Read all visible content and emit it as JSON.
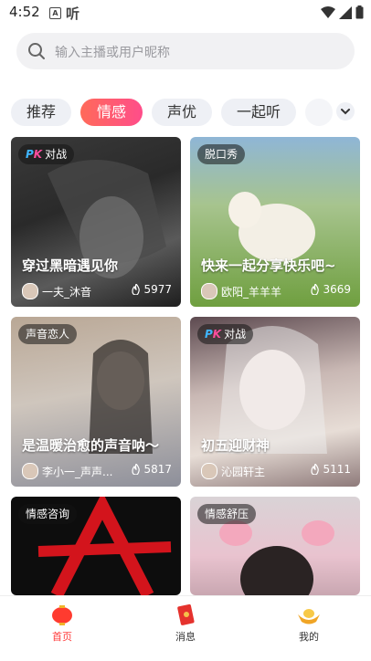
{
  "status_bar": {
    "time": "4:52",
    "notif_a": "A",
    "notif_b": "听"
  },
  "search": {
    "placeholder": "输入主播或用户昵称"
  },
  "tabs": [
    {
      "label": "推荐",
      "active": false
    },
    {
      "label": "情感",
      "active": true
    },
    {
      "label": "声优",
      "active": false
    },
    {
      "label": "一起听",
      "active": false
    }
  ],
  "cards": [
    {
      "tag": "对战",
      "pk": true,
      "title": "穿过黑暗遇见你",
      "user": "一夫_沐音",
      "heat": "5977"
    },
    {
      "tag": "脱口秀",
      "pk": false,
      "title": "快来一起分享快乐吧~",
      "user": "欧阳_羊羊羊",
      "heat": "3669"
    },
    {
      "tag": "声音恋人",
      "pk": false,
      "title": "是温暖治愈的声音呐～",
      "user": "李小一_声声...",
      "heat": "5817"
    },
    {
      "tag": "对战",
      "pk": true,
      "title": "初五迎财神",
      "user": "沁园轩主",
      "heat": "5111"
    },
    {
      "tag": "情感咨询",
      "pk": false,
      "title": "",
      "user": "",
      "heat": ""
    },
    {
      "tag": "情感舒压",
      "pk": false,
      "title": "",
      "user": "",
      "heat": ""
    }
  ],
  "nav": [
    {
      "label": "首页",
      "icon": "lantern-icon",
      "active": true
    },
    {
      "label": "消息",
      "icon": "red-envelope-icon",
      "active": false
    },
    {
      "label": "我的",
      "icon": "gold-ingot-icon",
      "active": false
    }
  ],
  "colors": {
    "accent": "#ff4d6a",
    "nav_active": "#ff3b3b"
  }
}
